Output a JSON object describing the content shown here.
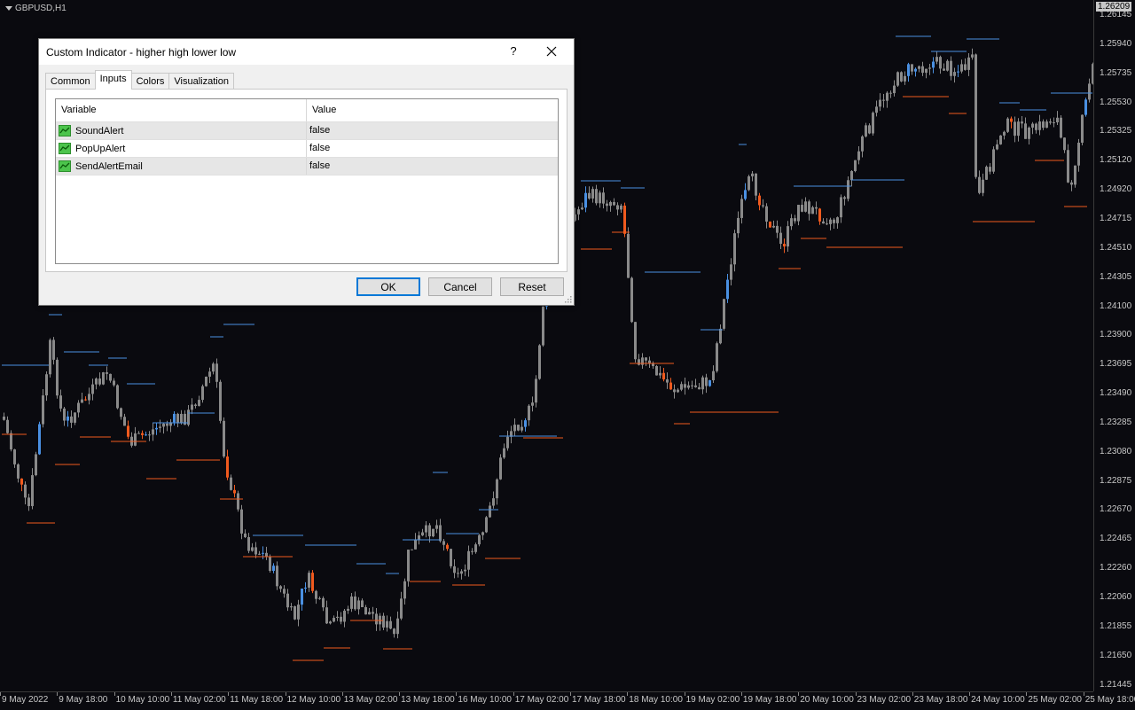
{
  "chart": {
    "symbol": "GBPUSD,H1",
    "current_price": "1.26209",
    "price_labels": [
      "1.26145",
      "1.25940",
      "1.25735",
      "1.25530",
      "1.25325",
      "1.25120",
      "1.24920",
      "1.24715",
      "1.24510",
      "1.24305",
      "1.24100",
      "1.23900",
      "1.23695",
      "1.23490",
      "1.23285",
      "1.23080",
      "1.22875",
      "1.22670",
      "1.22465",
      "1.22260",
      "1.22060",
      "1.21855",
      "1.21650",
      "1.21445"
    ],
    "time_labels": [
      "9 May 2022",
      "9 May 18:00",
      "10 May 10:00",
      "11 May 02:00",
      "11 May 18:00",
      "12 May 10:00",
      "13 May 02:00",
      "13 May 18:00",
      "16 May 10:00",
      "17 May 02:00",
      "17 May 18:00",
      "18 May 10:00",
      "19 May 02:00",
      "19 May 18:00",
      "20 May 10:00",
      "23 May 02:00",
      "23 May 18:00",
      "24 May 10:00",
      "25 May 02:00",
      "25 May 18:00"
    ],
    "colors": {
      "bull": "#4a90e2",
      "bear": "#f05a1e",
      "neutral": "#8a8a8a",
      "background": "#0a0a0f"
    }
  },
  "dialog": {
    "title": "Custom Indicator - higher high lower low",
    "help": "?",
    "tabs": [
      {
        "label": "Common"
      },
      {
        "label": "Inputs"
      },
      {
        "label": "Colors"
      },
      {
        "label": "Visualization"
      }
    ],
    "active_tab": "Inputs",
    "grid": {
      "col_variable": "Variable",
      "col_value": "Value",
      "rows": [
        {
          "variable": "SoundAlert",
          "value": "false"
        },
        {
          "variable": "PopUpAlert",
          "value": "false"
        },
        {
          "variable": "SendAlertEmail",
          "value": "false"
        }
      ]
    },
    "buttons": {
      "ok": "OK",
      "cancel": "Cancel",
      "reset": "Reset"
    }
  }
}
